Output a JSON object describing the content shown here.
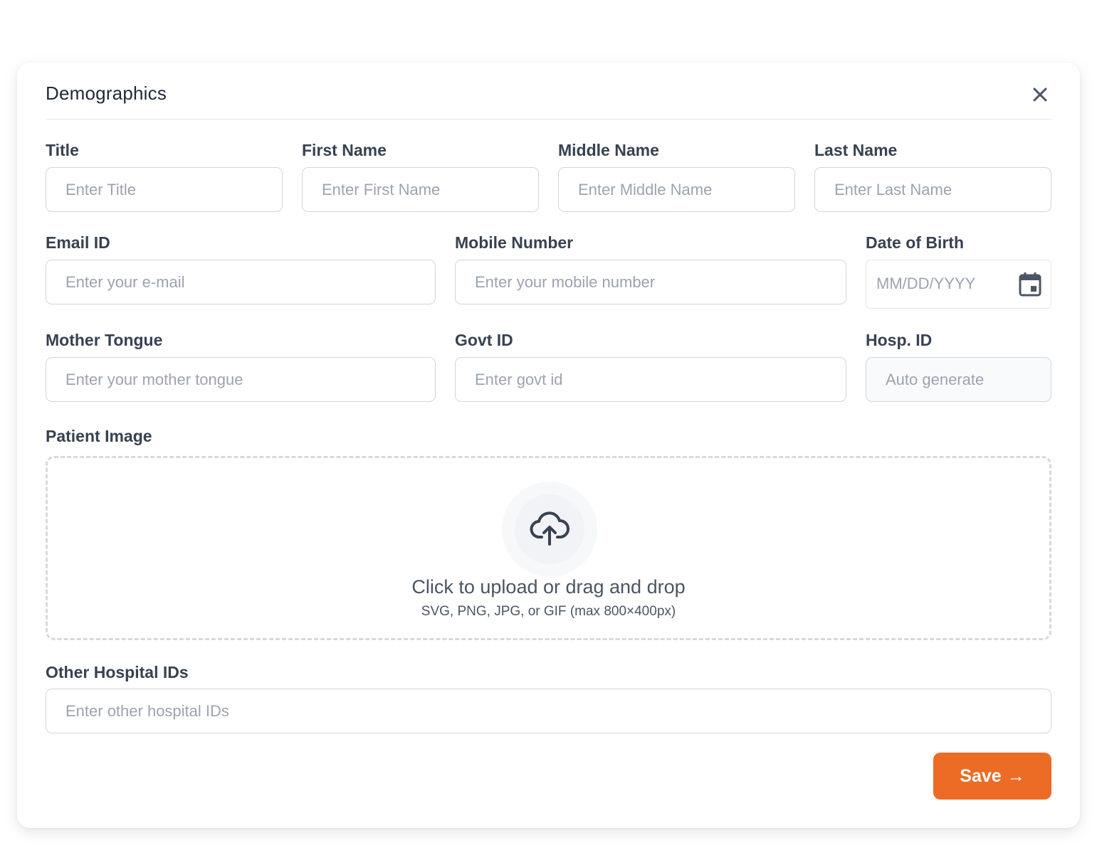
{
  "modal": {
    "title": "Demographics",
    "close_icon": "close-icon"
  },
  "fields": {
    "title": {
      "label": "Title",
      "placeholder": "Enter Title"
    },
    "first_name": {
      "label": "First Name",
      "placeholder": "Enter First Name"
    },
    "middle_name": {
      "label": "Middle Name",
      "placeholder": "Enter Middle Name"
    },
    "last_name": {
      "label": "Last Name",
      "placeholder": "Enter Last Name"
    },
    "email": {
      "label": "Email ID",
      "placeholder": "Enter your e-mail"
    },
    "mobile": {
      "label": "Mobile Number",
      "placeholder": "Enter your mobile number"
    },
    "dob": {
      "label": "Date of Birth",
      "placeholder": "MM/DD/YYYY",
      "icon": "calendar-icon"
    },
    "mother_tongue": {
      "label": "Mother Tongue",
      "placeholder": "Enter your mother tongue"
    },
    "govt_id": {
      "label": "Govt ID",
      "placeholder": "Enter govt id"
    },
    "hosp_id": {
      "label": "Hosp. ID",
      "placeholder": "Auto generate"
    },
    "patient_image": {
      "label": "Patient Image",
      "upload_text": "Click to upload or drag and drop",
      "upload_hint": "SVG, PNG, JPG, or GIF (max 800×400px)",
      "icon": "cloud-upload-icon"
    },
    "other_hospital_ids": {
      "label": "Other Hospital IDs",
      "placeholder": "Enter other hospital IDs"
    }
  },
  "actions": {
    "save_label": "Save",
    "save_arrow": "→"
  },
  "colors": {
    "accent": "#ec6b25",
    "border": "#d1d5db",
    "placeholder": "#9ca3af",
    "label": "#374151"
  }
}
